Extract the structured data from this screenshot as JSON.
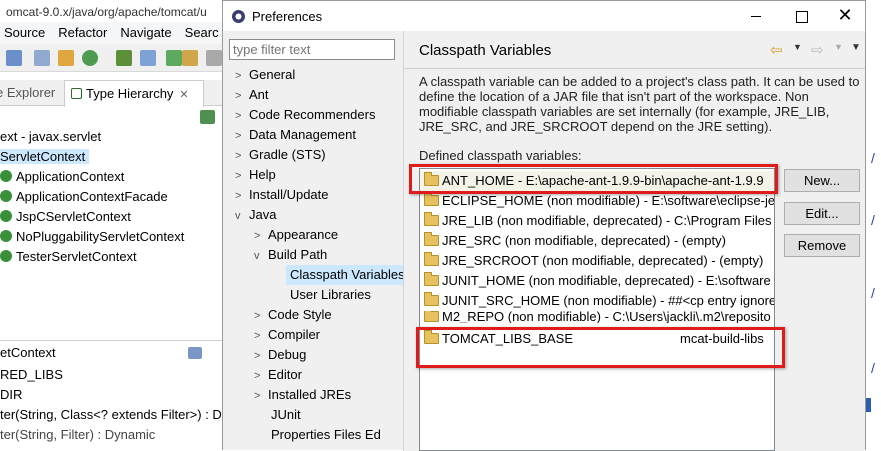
{
  "background": {
    "title": "omcat-9.0.x/java/org/apache/tomcat/u",
    "menu": [
      "Source",
      "Refactor",
      "Navigate",
      "Searc"
    ],
    "tabs": {
      "explorer": "e Explorer",
      "hierarchy": "Type Hierarchy"
    },
    "hierarchy_header": "ext - javax.servlet",
    "hierarchy_root": "ServletContext",
    "hierarchy_items": [
      "ApplicationContext",
      "ApplicationContextFacade",
      "JspCServletContext",
      "NoPluggabilityServletContext",
      "TesterServletContext"
    ],
    "outline_title": "etContext",
    "outline_items": [
      "RED_LIBS",
      "DIR",
      "ter(String, Class<? extends Filter>) : Dy",
      "ter(String, Filter) : Dynamic"
    ]
  },
  "dialog": {
    "title": "Preferences",
    "filter_placeholder": "type filter text",
    "tree": [
      {
        "label": "General",
        "level": 0,
        "state": "collapsed"
      },
      {
        "label": "Ant",
        "level": 0,
        "state": "collapsed"
      },
      {
        "label": "Code Recommenders",
        "level": 0,
        "state": "collapsed"
      },
      {
        "label": "Data Management",
        "level": 0,
        "state": "collapsed"
      },
      {
        "label": "Gradle (STS)",
        "level": 0,
        "state": "collapsed"
      },
      {
        "label": "Help",
        "level": 0,
        "state": "collapsed"
      },
      {
        "label": "Install/Update",
        "level": 0,
        "state": "collapsed"
      },
      {
        "label": "Java",
        "level": 0,
        "state": "expanded"
      },
      {
        "label": "Appearance",
        "level": 1,
        "state": "collapsed"
      },
      {
        "label": "Build Path",
        "level": 1,
        "state": "expanded"
      },
      {
        "label": "Classpath Variables",
        "level": 2,
        "state": "selected"
      },
      {
        "label": "User Libraries",
        "level": 2,
        "state": "leaf"
      },
      {
        "label": "Code Style",
        "level": 1,
        "state": "collapsed"
      },
      {
        "label": "Compiler",
        "level": 1,
        "state": "collapsed"
      },
      {
        "label": "Debug",
        "level": 1,
        "state": "collapsed"
      },
      {
        "label": "Editor",
        "level": 1,
        "state": "collapsed"
      },
      {
        "label": "Installed JREs",
        "level": 1,
        "state": "collapsed"
      },
      {
        "label": "JUnit",
        "level": 1,
        "state": "leaf"
      },
      {
        "label": "Properties Files Ed",
        "level": 1,
        "state": "leaf"
      }
    ],
    "page_title": "Classpath Variables",
    "description": "A classpath variable can be added to a project's class path. It can be used to define the location of a JAR file that isn't part of the workspace. Non modifiable classpath variables are set internally (for example, JRE_LIB, JRE_SRC, and JRE_SRCROOT depend on the JRE setting).",
    "defined_label": "Defined classpath variables:",
    "variables": [
      "ANT_HOME - E:\\apache-ant-1.9.9-bin\\apache-ant-1.9.9",
      "ECLIPSE_HOME (non modifiable) - E:\\software\\eclipse-jee",
      "JRE_LIB (non modifiable, deprecated) - C:\\Program Files",
      "JRE_SRC (non modifiable, deprecated) - (empty)",
      "JRE_SRCROOT (non modifiable, deprecated) - (empty)",
      "JUNIT_HOME (non modifiable, deprecated) - E:\\software",
      "JUNIT_SRC_HOME (non modifiable) - ##<cp entry ignore",
      "M2_REPO (non modifiable) - C:\\Users\\jackli\\.m2\\reposito",
      "TOMCAT_LIBS_BASE",
      "mcat-build-libs"
    ],
    "buttons": {
      "new": "New...",
      "edit": "Edit...",
      "remove": "Remove"
    },
    "close_glyph": "✕",
    "highlight_color": "#e01b1b"
  }
}
